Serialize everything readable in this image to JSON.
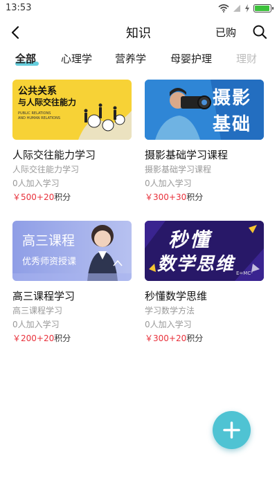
{
  "status": {
    "time": "13:53",
    "battery_level": 0.95
  },
  "header": {
    "title": "知识",
    "purchased_label": "已购"
  },
  "tabs": [
    {
      "label": "全部",
      "active": true
    },
    {
      "label": "心理学"
    },
    {
      "label": "营养学"
    },
    {
      "label": "母婴护理"
    },
    {
      "label": "理财"
    }
  ],
  "courses": [
    {
      "title": "人际交往能力学习",
      "subtitle": "人际交往能力学习",
      "enrolled": "0人加入学习",
      "price": "￥500",
      "points": "+20",
      "points_unit": "积分",
      "cover": {
        "line1": "公共关系",
        "line2": "与人际交往能力",
        "line3": "PUBLIC RELATIONS",
        "line4": "AND HUMAN RELATIONS"
      }
    },
    {
      "title": "摄影基础学习课程",
      "subtitle": "摄影基础学习课程",
      "enrolled": "0人加入学习",
      "price": "￥300",
      "points": "+30",
      "points_unit": "积分",
      "cover": {
        "line1": "摄影",
        "line2": "基础"
      }
    },
    {
      "title": "高三课程学习",
      "subtitle": "高三课程学习",
      "enrolled": "0人加入学习",
      "price": "￥200",
      "points": "+20",
      "points_unit": "积分",
      "cover": {
        "line1": "高三课程",
        "line2": "优秀师资授课"
      }
    },
    {
      "title": "秒懂数学思维",
      "subtitle": "学习数学方法",
      "enrolled": "0人加入学习",
      "price": "￥300",
      "points": "+20",
      "points_unit": "积分",
      "cover": {
        "line1": "秒懂",
        "line2": "数学思维",
        "line3": "E=MC²"
      }
    }
  ],
  "colors": {
    "accent": "#4fc3d3",
    "price": "#e8303a"
  }
}
